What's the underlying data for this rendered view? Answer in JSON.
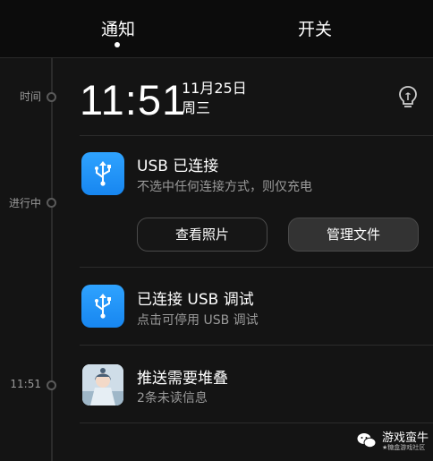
{
  "tabs": {
    "notify": "通知",
    "switches": "开关"
  },
  "timeline": {
    "time_label": "时间",
    "ongoing_label": "进行中",
    "time_1151": "11:51"
  },
  "header": {
    "clock": "11:51",
    "date": "11月25日",
    "weekday": "周三",
    "icon": "lightbulb-icon"
  },
  "notifications": [
    {
      "icon": "usb-icon",
      "title": "USB 已连接",
      "subtitle": "不选中任何连接方式，则仅充电",
      "actions": [
        "查看照片",
        "管理文件"
      ]
    },
    {
      "icon": "usb-icon",
      "title": "已连接 USB 调试",
      "subtitle": "点击可停用 USB 调试"
    },
    {
      "icon": "avatar-icon",
      "title": "推送需要堆叠",
      "subtitle": "2条未读信息"
    }
  ],
  "watermark": {
    "title": "游戏蛮牛",
    "subtitle": "★糖盒游戏社区"
  },
  "colors": {
    "background": "#141414",
    "icon_blue": "#1f8ff5",
    "secondary_text": "#9a9a9a"
  }
}
